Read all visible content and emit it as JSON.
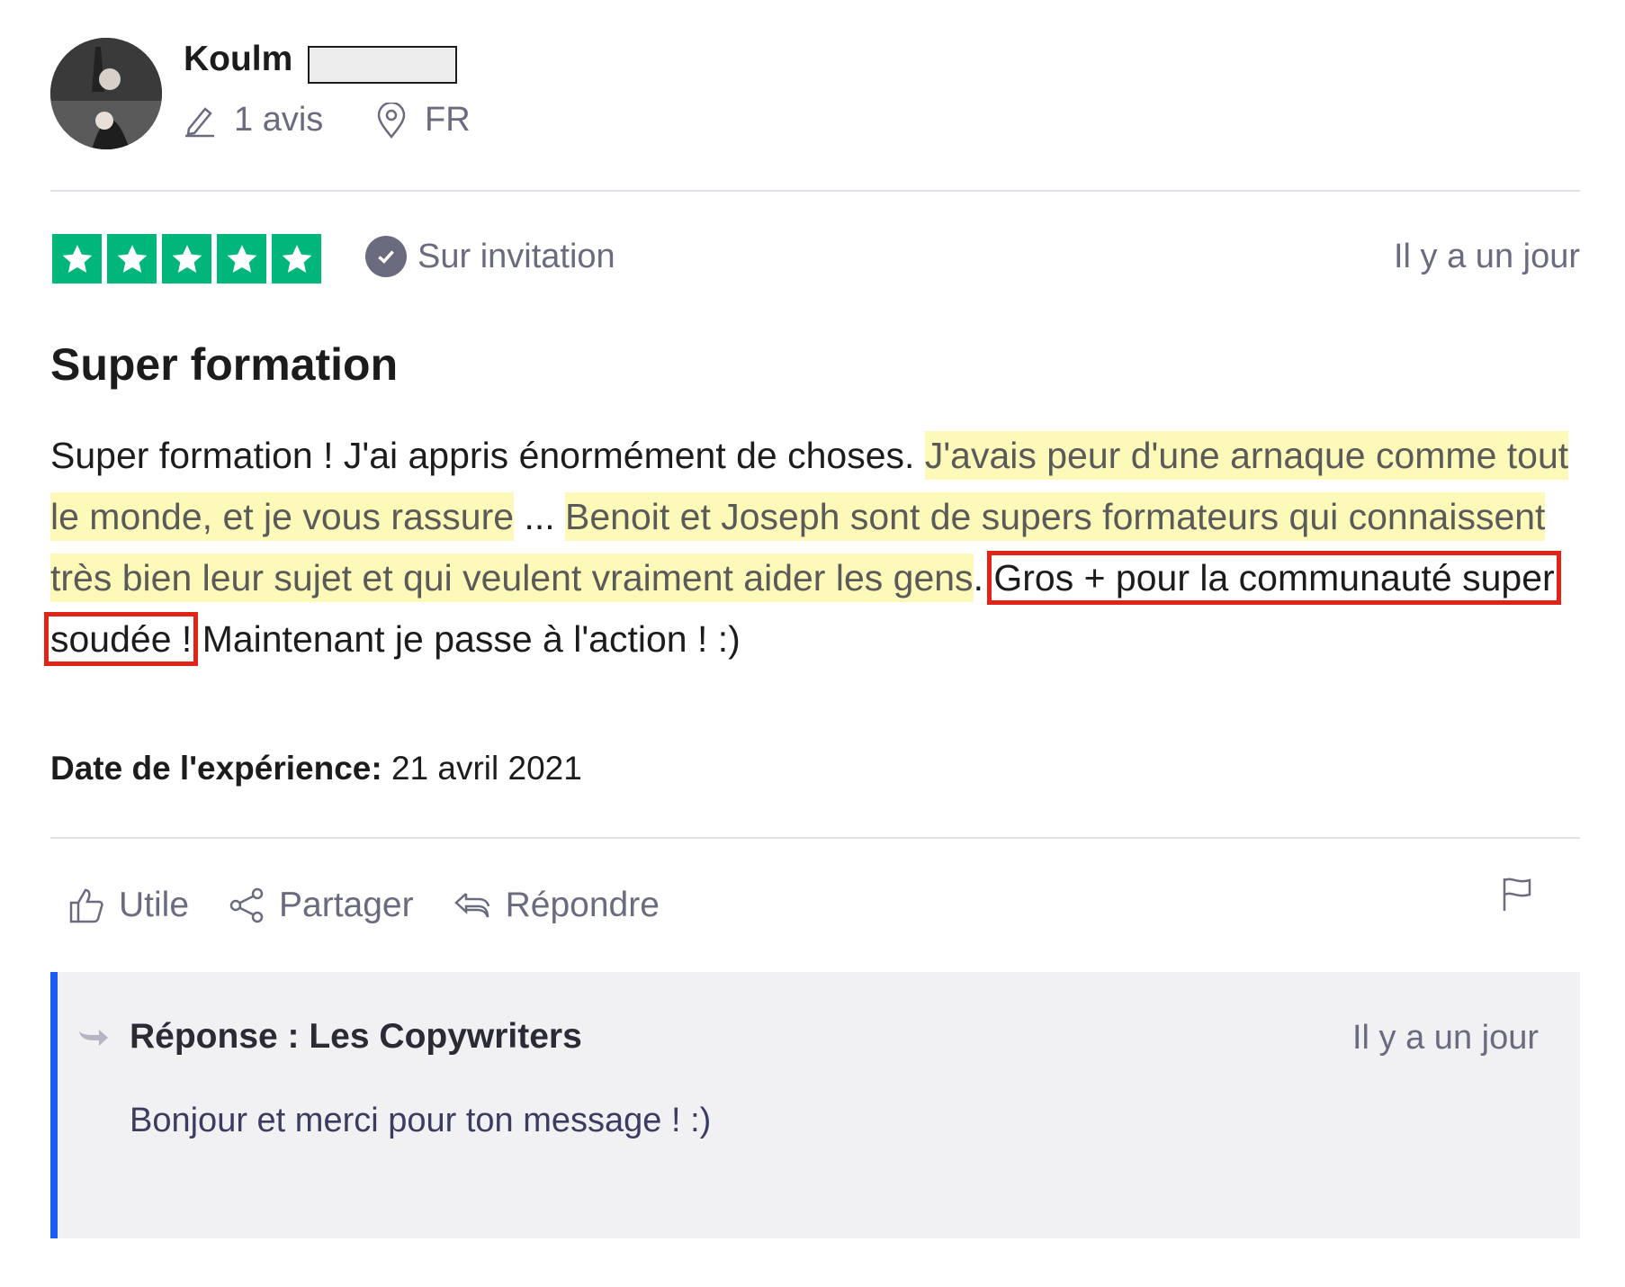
{
  "reviewer": {
    "name": "Koulm",
    "review_count": "1 avis",
    "country": "FR"
  },
  "review": {
    "stars": 5,
    "verification": "Sur invitation",
    "posted": "Il y a un jour",
    "title": "Super formation",
    "body": {
      "p1": "Super formation ! J'ai appris énormément de choses. ",
      "h1": "J'avais peur d'une arnaque comme tout le monde, et je vous rassure",
      "p2": " ... ",
      "h2": "Benoit et Joseph sont de supers formateurs qui connaissent très bien leur sujet et qui veulent vraiment aider les gens",
      "p3": ". ",
      "boxed": "Gros + pour la communauté super soudée !",
      "p4": " Maintenant je passe à l'action ! :)"
    },
    "experience_label": "Date de l'expérience:",
    "experience_date": " 21 avril 2021"
  },
  "actions": {
    "useful": "Utile",
    "share": "Partager",
    "reply": "Répondre"
  },
  "response": {
    "title": "Réponse : Les Copywriters",
    "posted": "Il y a un jour",
    "text": "Bonjour et merci pour ton message ! :)"
  },
  "colors": {
    "star_green": "#00b67a",
    "highlight": "#fdf9b8",
    "box_red": "#e02418",
    "reply_accent": "#1b5df2"
  }
}
